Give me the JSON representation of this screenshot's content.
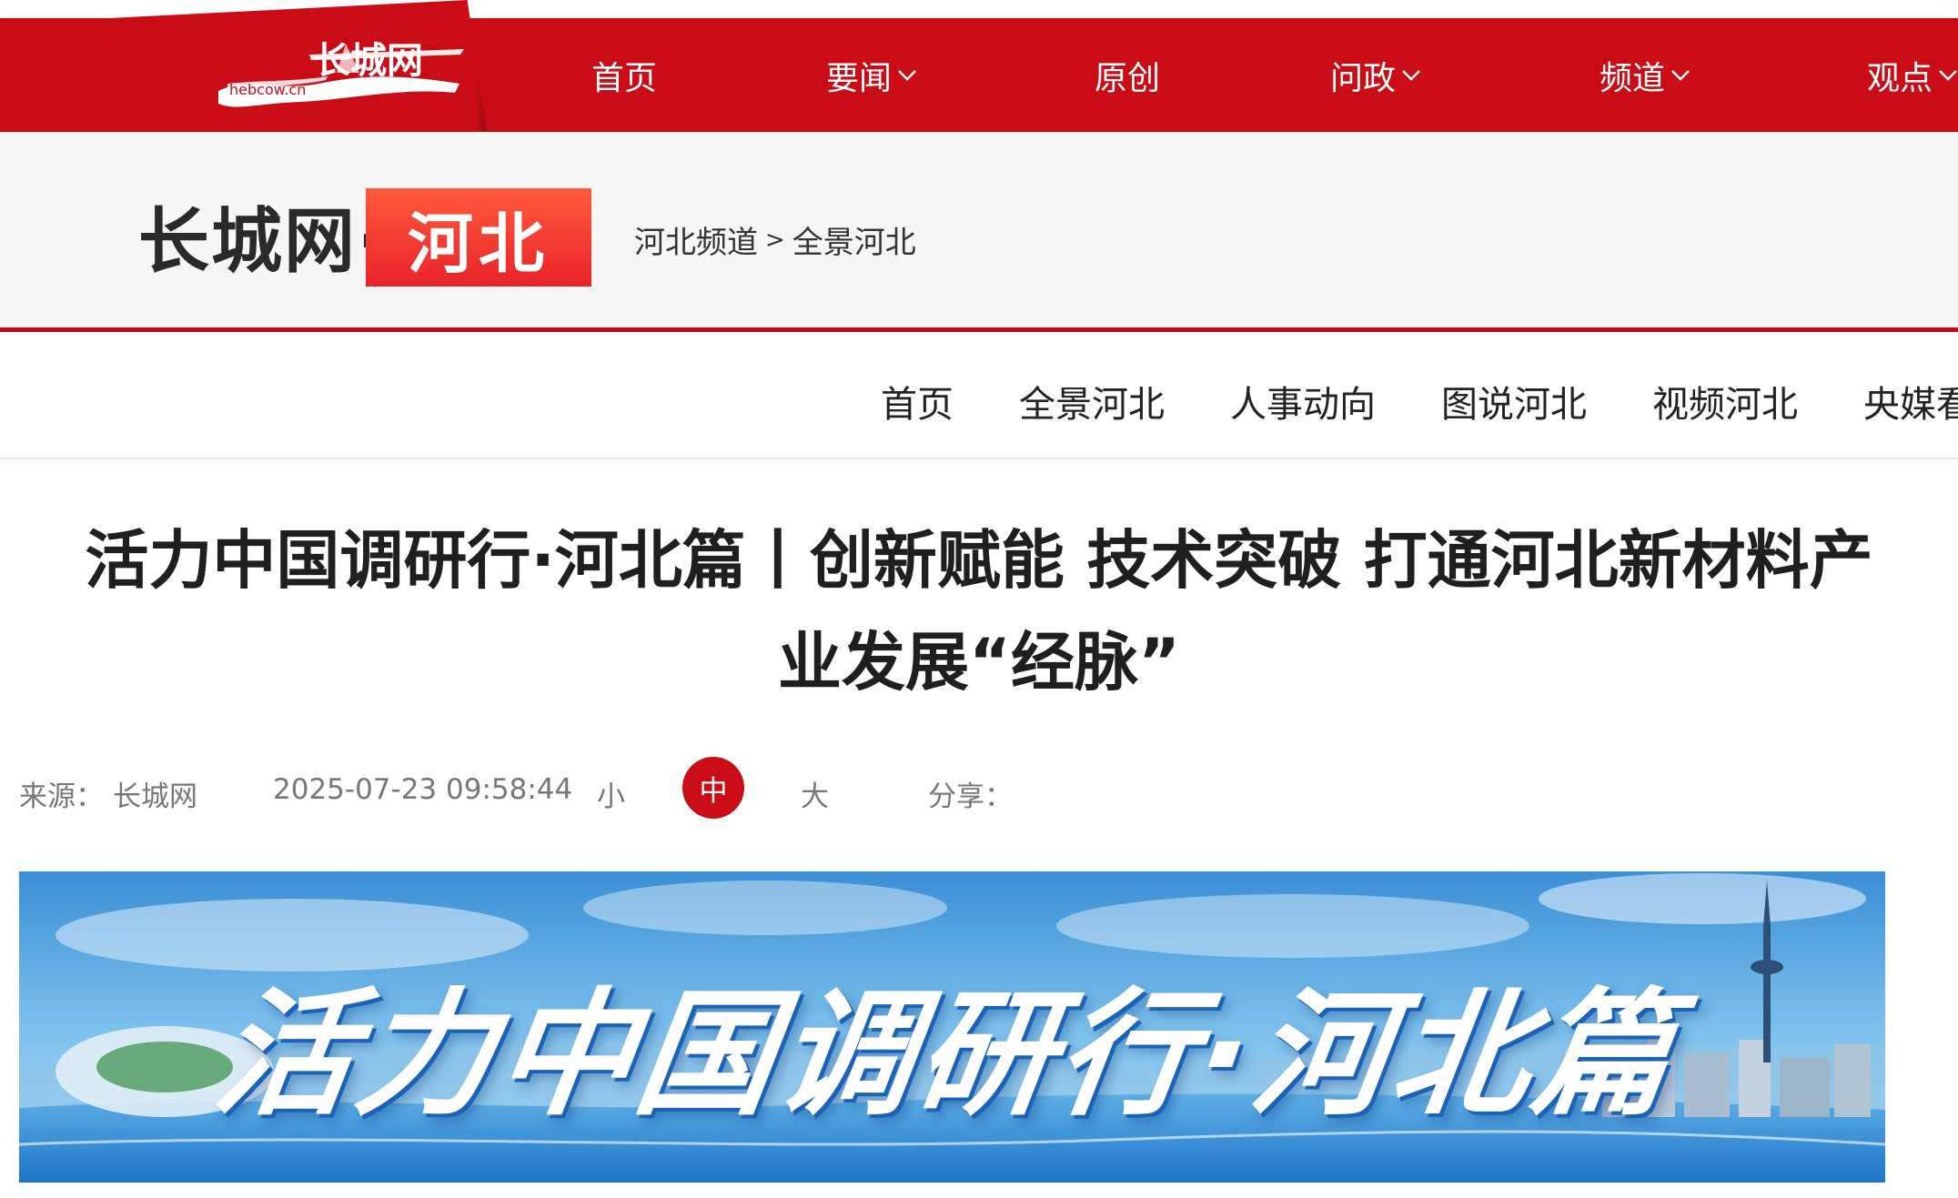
{
  "header": {
    "logo_text": "长城网",
    "logo_domain": "hebcow.cn",
    "nav": [
      {
        "label": "首页",
        "has_dropdown": false
      },
      {
        "label": "要闻",
        "has_dropdown": true
      },
      {
        "label": "原创",
        "has_dropdown": false
      },
      {
        "label": "问政",
        "has_dropdown": true
      },
      {
        "label": "频道",
        "has_dropdown": true
      },
      {
        "label": "观点",
        "has_dropdown": true
      }
    ]
  },
  "channel": {
    "brand": "长城网·",
    "badge": "河北",
    "breadcrumb": [
      "河北频道",
      "全景河北"
    ],
    "breadcrumb_sep": ">"
  },
  "subnav": [
    "首页",
    "全景河北",
    "人事动向",
    "图说河北",
    "视频河北",
    "央媒看"
  ],
  "article": {
    "title_line1": "活力中国调研行·河北篇丨创新赋能 技术突破 打通河北新材料产",
    "title_line2": "业发展“经脉”",
    "source_label": "来源：",
    "source_value": "长城网",
    "datetime": "2025-07-23 09:58:44",
    "font_sizes": [
      "小",
      "中",
      "大"
    ],
    "selected_font_size": "中",
    "share_label": "分享："
  },
  "banner": {
    "text": "活力中国调研行·河北篇"
  },
  "colors": {
    "brand_red": "#c90c16",
    "badge_red": "#e8232a",
    "channel_bg": "#f6f6f6"
  }
}
